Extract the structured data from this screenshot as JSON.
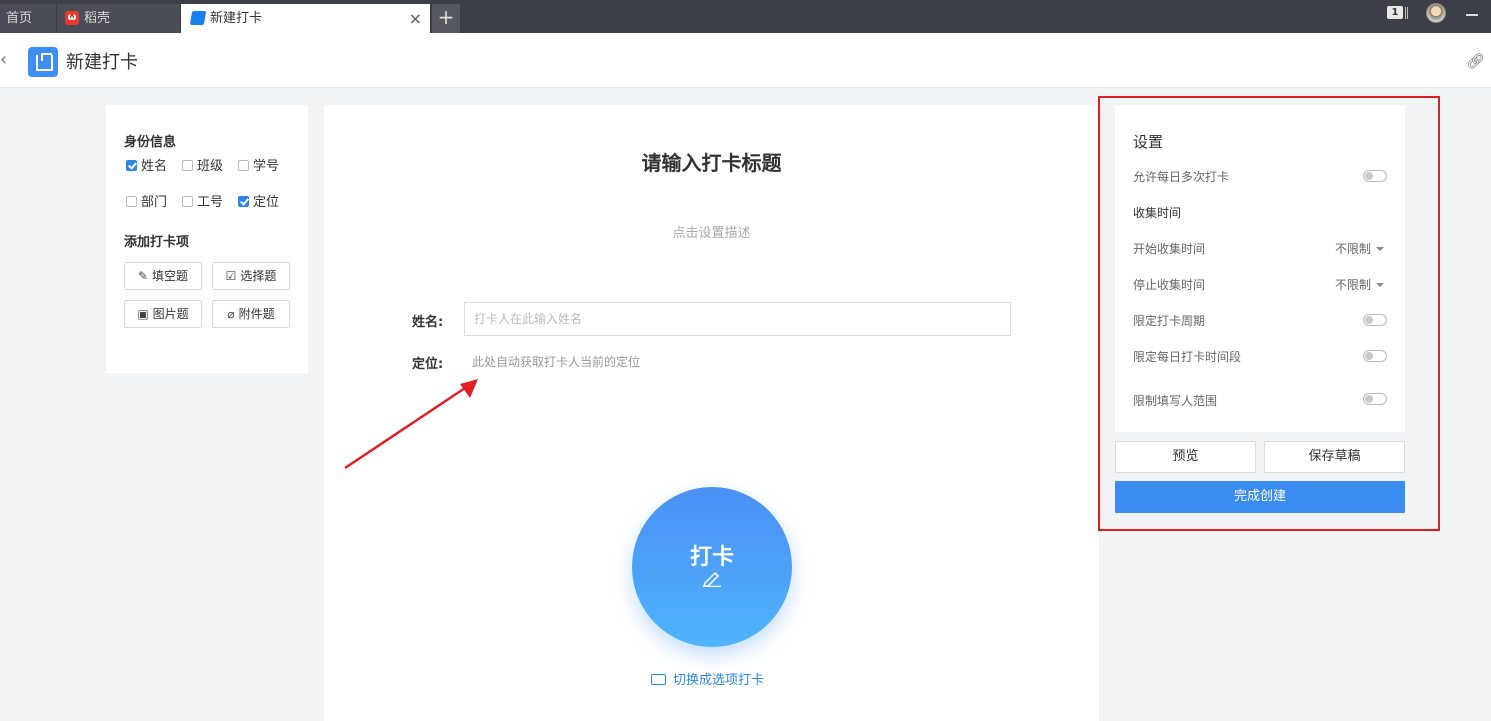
{
  "browser": {
    "tabs": [
      {
        "label": "首页"
      },
      {
        "label": "稻壳"
      },
      {
        "label": "新建打卡"
      }
    ],
    "new_tab": "+",
    "close": "×",
    "window_count": "1"
  },
  "header": {
    "back": "‹",
    "title": "新建打卡"
  },
  "left_panel": {
    "identity_title": "身份信息",
    "identity_fields": [
      {
        "label": "姓名",
        "checked": true
      },
      {
        "label": "班级",
        "checked": false
      },
      {
        "label": "学号",
        "checked": false
      },
      {
        "label": "部门",
        "checked": false
      },
      {
        "label": "工号",
        "checked": false
      },
      {
        "label": "定位",
        "checked": true
      }
    ],
    "add_title": "添加打卡项",
    "add_items": [
      {
        "label": "填空题",
        "icon": "pencil-icon"
      },
      {
        "label": "选择题",
        "icon": "checkbox-icon"
      },
      {
        "label": "图片题",
        "icon": "image-icon"
      },
      {
        "label": "附件题",
        "icon": "paperclip-icon"
      }
    ]
  },
  "form": {
    "title": "请输入打卡标题",
    "description": "点击设置描述",
    "name_label": "姓名:",
    "name_placeholder": "打卡人在此输入姓名",
    "location_label": "定位:",
    "location_hint": "此处自动获取打卡人当前的定位",
    "checkin_button": "打卡",
    "switch_link": "切换成选项打卡"
  },
  "settings": {
    "title": "设置",
    "rows": [
      {
        "label": "允许每日多次打卡",
        "control": "toggle",
        "on": false
      },
      {
        "label": "收集时间",
        "control": "none"
      },
      {
        "label": "开始收集时间",
        "control": "dropdown",
        "value": "不限制"
      },
      {
        "label": "停止收集时间",
        "control": "dropdown",
        "value": "不限制"
      },
      {
        "label": "限定打卡周期",
        "control": "toggle",
        "on": false
      },
      {
        "label": "限定每日打卡时间段",
        "control": "toggle",
        "on": false
      },
      {
        "label": "限制填写人范围",
        "control": "toggle",
        "on": false
      }
    ],
    "preview_button": "预览",
    "save_draft_button": "保存草稿",
    "create_button": "完成创建"
  },
  "colors": {
    "accent": "#3b8cf0",
    "annotation": "#e02020",
    "tabstrip": "#3c3f46"
  }
}
